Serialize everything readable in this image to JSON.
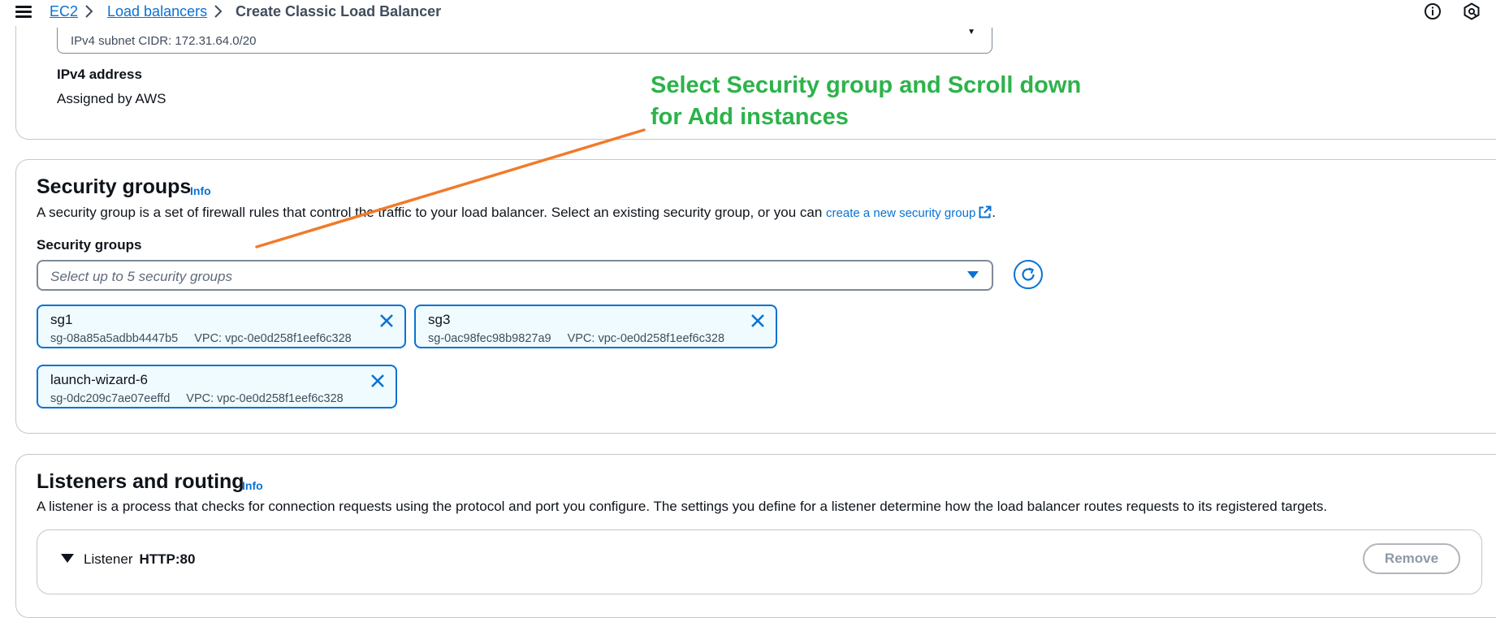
{
  "breadcrumb": {
    "ec2": "EC2",
    "load_balancers": "Load balancers",
    "current": "Create Classic Load Balancer"
  },
  "top_icons": [
    "info-icon",
    "notifications-icon"
  ],
  "network": {
    "subnet_cidr": "IPv4 subnet CIDR: 172.31.64.0/20",
    "ipv4_label": "IPv4 address",
    "ipv4_value": "Assigned by AWS"
  },
  "annotation": {
    "line1": "Select Security group and Scroll down",
    "line2": "for Add instances",
    "color": "#2cb34a",
    "arrow_color": "#f07b2a"
  },
  "security_groups": {
    "title": "Security groups",
    "info": "Info",
    "description": "A security group is a set of firewall rules that control the traffic to your load balancer. Select an existing security group, or you can ",
    "create_link": "create a new security group",
    "description_end": ".",
    "field_label": "Security groups",
    "placeholder": "Select up to 5 security groups",
    "selected": [
      {
        "name": "sg1",
        "id": "sg-08a85a5adbb4447b5",
        "vpc": "VPC: vpc-0e0d258f1eef6c328"
      },
      {
        "name": "sg3",
        "id": "sg-0ac98fec98b9827a9",
        "vpc": "VPC: vpc-0e0d258f1eef6c328"
      },
      {
        "name": "launch-wizard-6",
        "id": "sg-0dc209c7ae07eeffd",
        "vpc": "VPC: vpc-0e0d258f1eef6c328"
      }
    ]
  },
  "listeners": {
    "title": "Listeners and routing",
    "info": "Info",
    "description": "A listener is a process that checks for connection requests using the protocol and port you configure. The settings you define for a listener determine how the load balancer routes requests to its registered targets.",
    "listener_label": "Listener",
    "listener_value": "HTTP:80",
    "remove_label": "Remove"
  },
  "colors": {
    "link": "#0972d3",
    "token_bg": "#f0fbff",
    "text": "#0f141a"
  }
}
